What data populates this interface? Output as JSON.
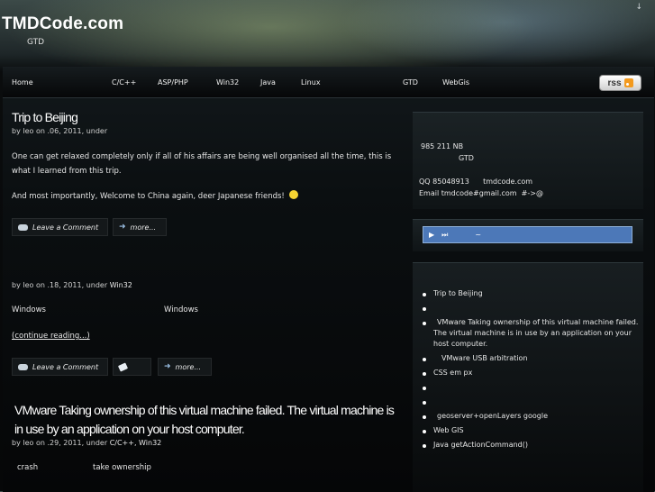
{
  "header": {
    "title": "TMDCode.com",
    "subtitle": "GTD",
    "corner_arrow": "↓"
  },
  "nav": {
    "items": [
      "Home",
      "C/C++",
      "ASP/PHP",
      "Win32",
      "Java",
      "Linux",
      "GTD",
      "WebGis"
    ],
    "rss_label": "rss"
  },
  "posts": [
    {
      "title": "Trip to Beijing",
      "meta": {
        "by": "by leo on  .06, 2011, under"
      },
      "paragraphs": [
        "One can get relaxed completely only if  all of his affairs are being well organised all the time, this is what I learned from this trip.",
        "And most importantly, Welcome to China again, deer Japanese friends!"
      ],
      "buttons": {
        "comment": "Leave a Comment",
        "more": "more..."
      }
    },
    {
      "meta": {
        "by": "by leo on  .18, 2011, under",
        "cat": "Win32"
      },
      "text_left": "Windows",
      "text_right": "Windows",
      "continue": "(continue reading...)",
      "buttons": {
        "comment": "Leave a Comment",
        "more": "more..."
      }
    },
    {
      "title": "VMware Taking ownership of this virtual machine failed. The virtual machine is in use by an application on your host computer.",
      "meta": {
        "by": "by leo on  .29, 2011, under",
        "cat": "C/C++, Win32"
      },
      "text_left": "crash",
      "text_right": "take ownership"
    }
  ],
  "sidebar": {
    "info": {
      "line1": "985 211 NB",
      "line2": "GTD",
      "line3": "QQ 85048913      tmdcode.com",
      "line4": "Email tmdcode#gmail.com  #->@"
    },
    "player": {
      "play": "▶",
      "next": "⏭",
      "track": "~"
    },
    "recent": [
      "Trip to Beijing",
      "",
      "VMware Taking ownership of this virtual machine failed. The virtual machine is in use by an application on your host computer.",
      "VMware USB arbitration",
      "CSS   em px",
      "",
      "",
      "geoserver+openLayers google",
      "Web GIS",
      "Java getActionCommand()"
    ]
  }
}
